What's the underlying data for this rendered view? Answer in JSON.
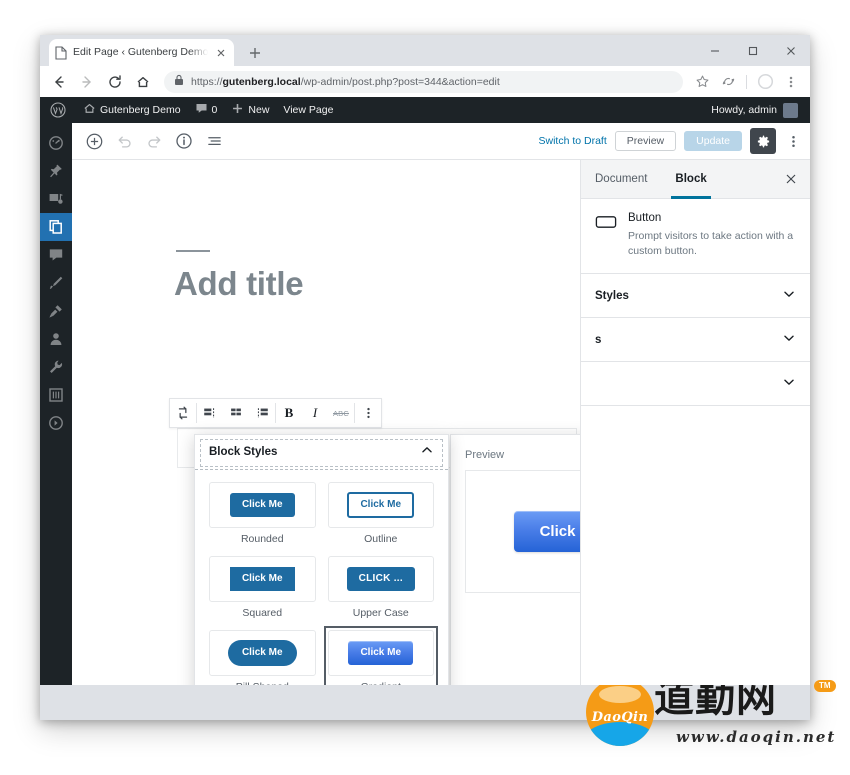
{
  "browser": {
    "tab": {
      "title": "Edit Page ‹ Gutenberg Demo — \\",
      "icon": "page-icon",
      "close_icon": "close-icon"
    },
    "new_tab_label": "+",
    "nav": {
      "back": "back-arrow-icon",
      "forward": "forward-arrow-icon",
      "reload": "reload-icon",
      "home": "home-icon"
    },
    "omnibox": {
      "lock_icon": "lock-icon",
      "url_scheme": "https://",
      "url_host": "gutenberg.local",
      "url_path": "/wp-admin/post.php?post=344&action=edit",
      "bookmark_icon": "star-icon",
      "extension_icon": "extension-icon",
      "profile_icon": "profile-icon",
      "menu_icon": "kebab-menu-icon"
    },
    "window_controls": {
      "minimize": "minimize-icon",
      "maximize": "maximize-icon",
      "close": "close-icon"
    }
  },
  "adminbar": {
    "wp_logo": "wordpress-logo-icon",
    "site_name": "Gutenberg Demo",
    "site_icon": "home-icon",
    "comments_icon": "comment-bubble-icon",
    "comments_count": "0",
    "new_icon": "plus-icon",
    "new_label": "New",
    "view_page_label": "View Page",
    "howdy": "Howdy, admin",
    "avatar": "avatar"
  },
  "adminmenu": {
    "items": [
      {
        "icon": "dashboard-icon",
        "name": "dashboard",
        "current": false
      },
      {
        "icon": "pin-posts-icon",
        "name": "posts",
        "current": false
      },
      {
        "icon": "media-icon",
        "name": "media",
        "current": false
      },
      {
        "icon": "pages-icon",
        "name": "pages",
        "current": true
      },
      {
        "icon": "comments-icon",
        "name": "comments",
        "current": false
      },
      {
        "icon": "appearance-brush-icon",
        "name": "appearance",
        "current": false
      },
      {
        "icon": "plugins-plug-icon",
        "name": "plugins",
        "current": false
      },
      {
        "icon": "users-icon",
        "name": "users",
        "current": false
      },
      {
        "icon": "tools-wrench-icon",
        "name": "tools",
        "current": false
      },
      {
        "icon": "settings-sliders-icon",
        "name": "settings",
        "current": false
      },
      {
        "icon": "collapse-menu-icon",
        "name": "collapse-menu",
        "current": false
      }
    ]
  },
  "editor_header": {
    "add_block_icon": "plus-circle-icon",
    "undo_icon": "undo-icon",
    "redo_icon": "redo-icon",
    "info_icon": "info-circle-icon",
    "list_view_icon": "list-view-icon",
    "switch_to_draft": "Switch to Draft",
    "preview": "Preview",
    "update": "Update",
    "settings_gear_icon": "gear-icon",
    "more_menu_icon": "kebab-menu-icon"
  },
  "canvas": {
    "title_placeholder": "Add title",
    "block_toolbar": {
      "transform_icon": "block-transform-icon",
      "align_left_icon": "align-left-icon",
      "align_center_icon": "align-center-icon",
      "align_right_icon": "align-right-icon",
      "bold_label": "B",
      "italic_label": "I",
      "strike_label": "ABC",
      "more_icon": "kebab-menu-icon"
    }
  },
  "sidebar": {
    "tabs": [
      {
        "label": "Document",
        "active": false
      },
      {
        "label": "Block",
        "active": true
      }
    ],
    "close_icon": "close-icon",
    "block_card": {
      "icon": "button-block-icon",
      "title": "Button",
      "description": "Prompt visitors to take action with a custom button."
    },
    "panels": [
      {
        "label": "Styles",
        "chevron": "chevron-down-icon"
      },
      {
        "label": "s",
        "chevron": "chevron-down-icon"
      },
      {
        "label": "",
        "chevron": "chevron-down-icon"
      }
    ]
  },
  "block_styles_popover": {
    "title": "Block Styles",
    "collapse_icon": "chevron-up-icon",
    "styles": [
      {
        "label": "Rounded",
        "variant": "rounded",
        "button_text": "Click Me",
        "selected": false
      },
      {
        "label": "Outline",
        "variant": "outline",
        "button_text": "Click Me",
        "selected": false
      },
      {
        "label": "Squared",
        "variant": "squared",
        "button_text": "Click Me",
        "selected": false
      },
      {
        "label": "Upper Case",
        "variant": "upper",
        "button_text": "CLICK ...",
        "selected": false
      },
      {
        "label": "Pill Shaped",
        "variant": "pill",
        "button_text": "Click Me",
        "selected": false
      },
      {
        "label": "Gradient",
        "variant": "gradient",
        "button_text": "Click Me",
        "selected": true
      }
    ]
  },
  "preview_popover": {
    "label": "Preview",
    "button_text": "Click Me"
  },
  "watermark": {
    "brand": "DaoQin",
    "chinese": "道勤网",
    "tm": "TM",
    "url": "www.daoqin.net"
  },
  "colors": {
    "wp_blue": "#1e6ba1",
    "admin_dark": "#1d2327",
    "accent_link": "#0073aa",
    "tab_underline": "#00739c",
    "gradient_top": "#6b9cf5",
    "gradient_bottom": "#2563d6",
    "watermark_orange": "#f59b16",
    "watermark_blue": "#16a6e8"
  }
}
